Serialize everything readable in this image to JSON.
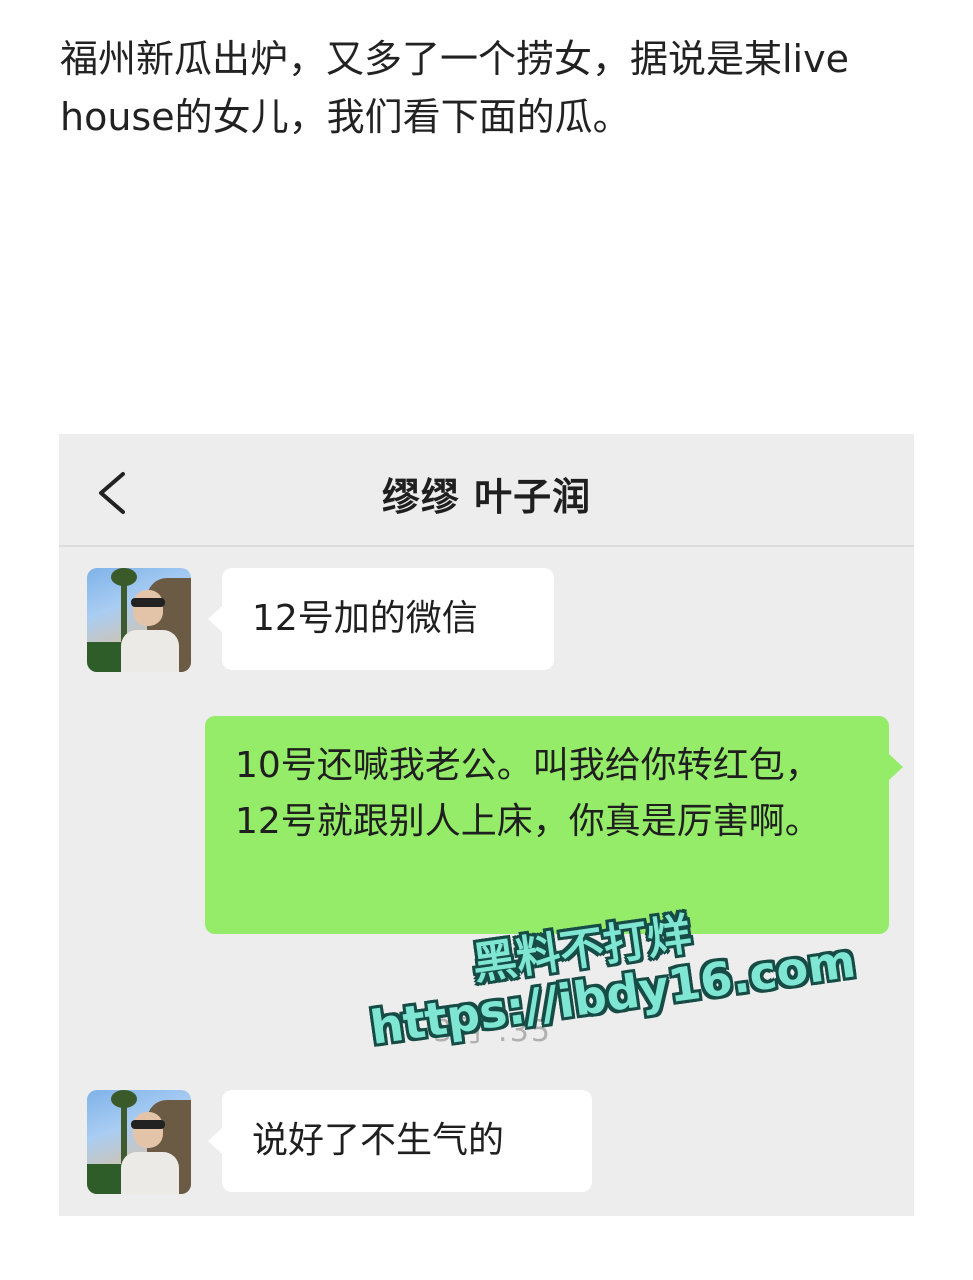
{
  "post": {
    "text": "福州新瓜出炉，又多了一个捞女，据说是某live house的女儿，我们看下面的瓜。"
  },
  "chat": {
    "back_icon": "chevron-left-icon",
    "title": "缪缪 叶子润",
    "messages": [
      {
        "side": "left",
        "text": "12号加的微信"
      },
      {
        "side": "right",
        "text": "10号还喊我老公。叫我给你转红包，12号就跟别人上床，你真是厉害啊。"
      },
      {
        "side": "left",
        "text": "说好了不生气的"
      }
    ],
    "timestamp_partial": "3月  :35",
    "colors": {
      "sent_bubble": "#95ec69",
      "received_bubble": "#ffffff",
      "background": "#ededed"
    }
  },
  "watermark": {
    "line1": "黑料不打烊",
    "line2": "https://ibdy16.com"
  }
}
